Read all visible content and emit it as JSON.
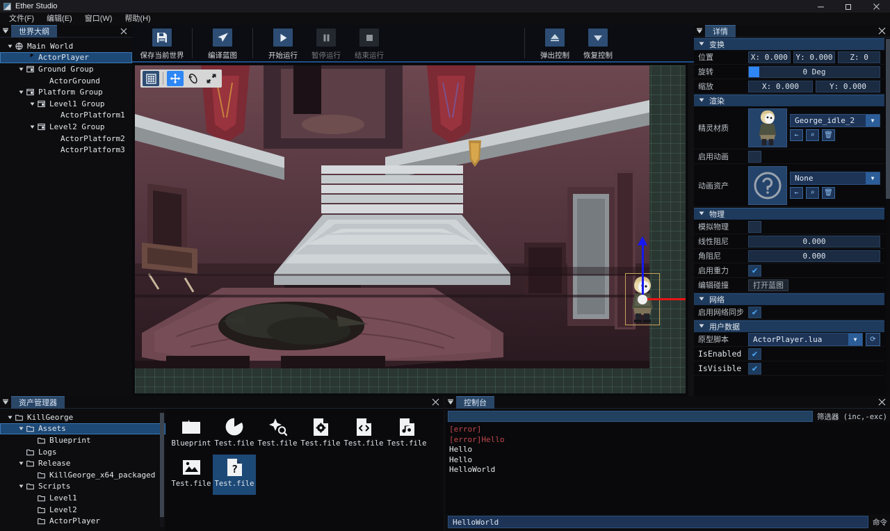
{
  "window": {
    "title": "Ether Studio",
    "minimize": "minimize-icon",
    "maximize": "maximize-icon",
    "close": "close-icon"
  },
  "menubar": {
    "items": [
      {
        "label": "文件(F)",
        "name": "menu-file"
      },
      {
        "label": "编辑(E)",
        "name": "menu-edit"
      },
      {
        "label": "窗口(W)",
        "name": "menu-window"
      },
      {
        "label": "帮助(H)",
        "name": "menu-help"
      }
    ]
  },
  "toolbar": {
    "groups": [
      {
        "buttons": [
          {
            "label": "保存当前世界",
            "icon": "save-icon",
            "enabled": true
          }
        ]
      },
      {
        "buttons": [
          {
            "label": "编译蓝图",
            "icon": "compile-icon",
            "enabled": true
          }
        ]
      },
      {
        "buttons": [
          {
            "label": "开始运行",
            "icon": "play-icon",
            "enabled": true
          },
          {
            "label": "暂停运行",
            "icon": "pause-icon",
            "enabled": false
          },
          {
            "label": "结束运行",
            "icon": "stop-icon",
            "enabled": false
          }
        ]
      },
      {
        "buttons": [
          {
            "label": "弹出控制",
            "icon": "eject-icon",
            "enabled": true
          },
          {
            "label": "恢复控制",
            "icon": "restore-icon",
            "enabled": true
          }
        ]
      }
    ]
  },
  "outliner": {
    "tab": "世界大纲",
    "close": "close-icon",
    "items": [
      {
        "label": "Main World",
        "depth": 0,
        "icon": "world-icon",
        "expanded": true,
        "selected": false
      },
      {
        "label": "ActorPlayer",
        "depth": 1,
        "icon": "actor-icon",
        "expanded": null,
        "selected": true
      },
      {
        "label": "Ground Group",
        "depth": 1,
        "icon": "group-icon",
        "expanded": true,
        "selected": false
      },
      {
        "label": "ActorGround",
        "depth": 2,
        "icon": "actor-icon",
        "expanded": null,
        "selected": false
      },
      {
        "label": "Platform Group",
        "depth": 1,
        "icon": "group-icon",
        "expanded": true,
        "selected": false
      },
      {
        "label": "Level1 Group",
        "depth": 2,
        "icon": "group-icon",
        "expanded": true,
        "selected": false
      },
      {
        "label": "ActorPlatform1",
        "depth": 3,
        "icon": "actor-icon",
        "expanded": null,
        "selected": false
      },
      {
        "label": "Level2 Group",
        "depth": 2,
        "icon": "group-icon",
        "expanded": true,
        "selected": false
      },
      {
        "label": "ActorPlatform2",
        "depth": 3,
        "icon": "actor-icon",
        "expanded": null,
        "selected": false
      },
      {
        "label": "ActorPlatform3",
        "depth": 3,
        "icon": "actor-icon",
        "expanded": null,
        "selected": false
      }
    ]
  },
  "viewport": {
    "tools": [
      {
        "name": "grid-toggle-icon",
        "active": false,
        "style": "bg"
      },
      {
        "name": "move-tool-icon",
        "active": true,
        "style": "on"
      },
      {
        "name": "rotate-tool-icon",
        "active": false,
        "style": ""
      },
      {
        "name": "scale-tool-icon",
        "active": false,
        "style": ""
      }
    ],
    "gizmo": {
      "x_axis_color": "#e81414",
      "y_axis_color": "#1718f0",
      "center_color": "#f2f2f2"
    },
    "selection_color": "#c7a55c"
  },
  "details": {
    "tab": "详情",
    "close": "close-icon",
    "sections": [
      {
        "title": "变换",
        "rows": [
          {
            "label": "位置",
            "type": "vec3",
            "values": [
              "X: 0.000",
              "Y: 0.000",
              "Z: 0"
            ]
          },
          {
            "label": "旋转",
            "type": "slider",
            "value": "0 Deg"
          },
          {
            "label": "缩放",
            "type": "vec2",
            "values": [
              "X: 0.000",
              "Y: 0.000"
            ]
          }
        ]
      },
      {
        "title": "渲染",
        "rows": [
          {
            "label": "精灵材质",
            "type": "asset",
            "value": "George_idle_2",
            "thumb": "sprite-thumb"
          },
          {
            "label": "启用动画",
            "type": "checkbox",
            "checked": false
          },
          {
            "label": "动画资产",
            "type": "asset",
            "value": "None",
            "thumb": "unknown-thumb"
          }
        ]
      },
      {
        "title": "物理",
        "rows": [
          {
            "label": "模拟物理",
            "type": "checkbox",
            "checked": false
          },
          {
            "label": "线性阻尼",
            "type": "number",
            "value": "0.000"
          },
          {
            "label": "角阻尼",
            "type": "number",
            "value": "0.000"
          },
          {
            "label": "启用重力",
            "type": "checkbox",
            "checked": true
          },
          {
            "label": "编辑碰撞",
            "type": "button",
            "value": "打开蓝图"
          }
        ]
      },
      {
        "title": "网络",
        "rows": [
          {
            "label": "启用网络同步",
            "type": "checkbox",
            "checked": true
          }
        ]
      },
      {
        "title": "用户数据",
        "rows": [
          {
            "label": "原型脚本",
            "type": "dropdown",
            "value": "ActorPlayer.lua",
            "refresh": "refresh-icon"
          },
          {
            "label": "IsEnabled",
            "type": "checkbox",
            "checked": true,
            "mono": true
          },
          {
            "label": "IsVisible",
            "type": "checkbox",
            "checked": true,
            "mono": true
          }
        ]
      }
    ],
    "asset_buttons": [
      "back-icon",
      "search-icon",
      "delete-icon"
    ]
  },
  "assets": {
    "tab": "资产管理器",
    "close": "close-icon",
    "tree": [
      {
        "label": "KillGeorge",
        "depth": 0,
        "expanded": true,
        "selected": false
      },
      {
        "label": "Assets",
        "depth": 1,
        "expanded": true,
        "selected": true
      },
      {
        "label": "Blueprint",
        "depth": 2,
        "expanded": null,
        "selected": false
      },
      {
        "label": "Logs",
        "depth": 1,
        "expanded": null,
        "selected": false
      },
      {
        "label": "Release",
        "depth": 1,
        "expanded": true,
        "selected": false
      },
      {
        "label": "KillGeorge_x64_packaged",
        "depth": 2,
        "expanded": null,
        "selected": false
      },
      {
        "label": "Scripts",
        "depth": 1,
        "expanded": true,
        "selected": false
      },
      {
        "label": "Level1",
        "depth": 2,
        "expanded": null,
        "selected": false
      },
      {
        "label": "Level2",
        "depth": 2,
        "expanded": null,
        "selected": false
      },
      {
        "label": "ActorPlayer",
        "depth": 2,
        "expanded": null,
        "selected": false
      }
    ],
    "files": [
      {
        "label": "Blueprint",
        "icon": "folder-icon",
        "selected": false
      },
      {
        "label": "Test.file",
        "icon": "actor-icon",
        "selected": false
      },
      {
        "label": "Test.file",
        "icon": "particle-icon",
        "selected": false
      },
      {
        "label": "Test.file",
        "icon": "config-icon",
        "selected": false
      },
      {
        "label": "Test.file",
        "icon": "code-icon",
        "selected": false
      },
      {
        "label": "Test.file",
        "icon": "audio-icon",
        "selected": false
      },
      {
        "label": "Test.file",
        "icon": "image-icon",
        "selected": false
      },
      {
        "label": "Test.file",
        "icon": "unknown-icon",
        "selected": true
      }
    ]
  },
  "console": {
    "tab": "控制台",
    "close": "close-icon",
    "filter_value": "",
    "filter_label": "筛选器 (inc,-exc)",
    "lines": [
      {
        "text": "[error]",
        "level": "error"
      },
      {
        "text": "[error]Hello",
        "level": "error"
      },
      {
        "text": "Hello",
        "level": "info"
      },
      {
        "text": "Hello",
        "level": "info"
      },
      {
        "text": "HelloWorld",
        "level": "info"
      }
    ],
    "command_value": "HelloWorld",
    "command_label": "命令"
  },
  "colors": {
    "accent": "#2f86f5",
    "tab_active": "#2a4667",
    "selection": "#1d4977",
    "section_header": "#1e3a5c",
    "error": "#c0474d"
  }
}
